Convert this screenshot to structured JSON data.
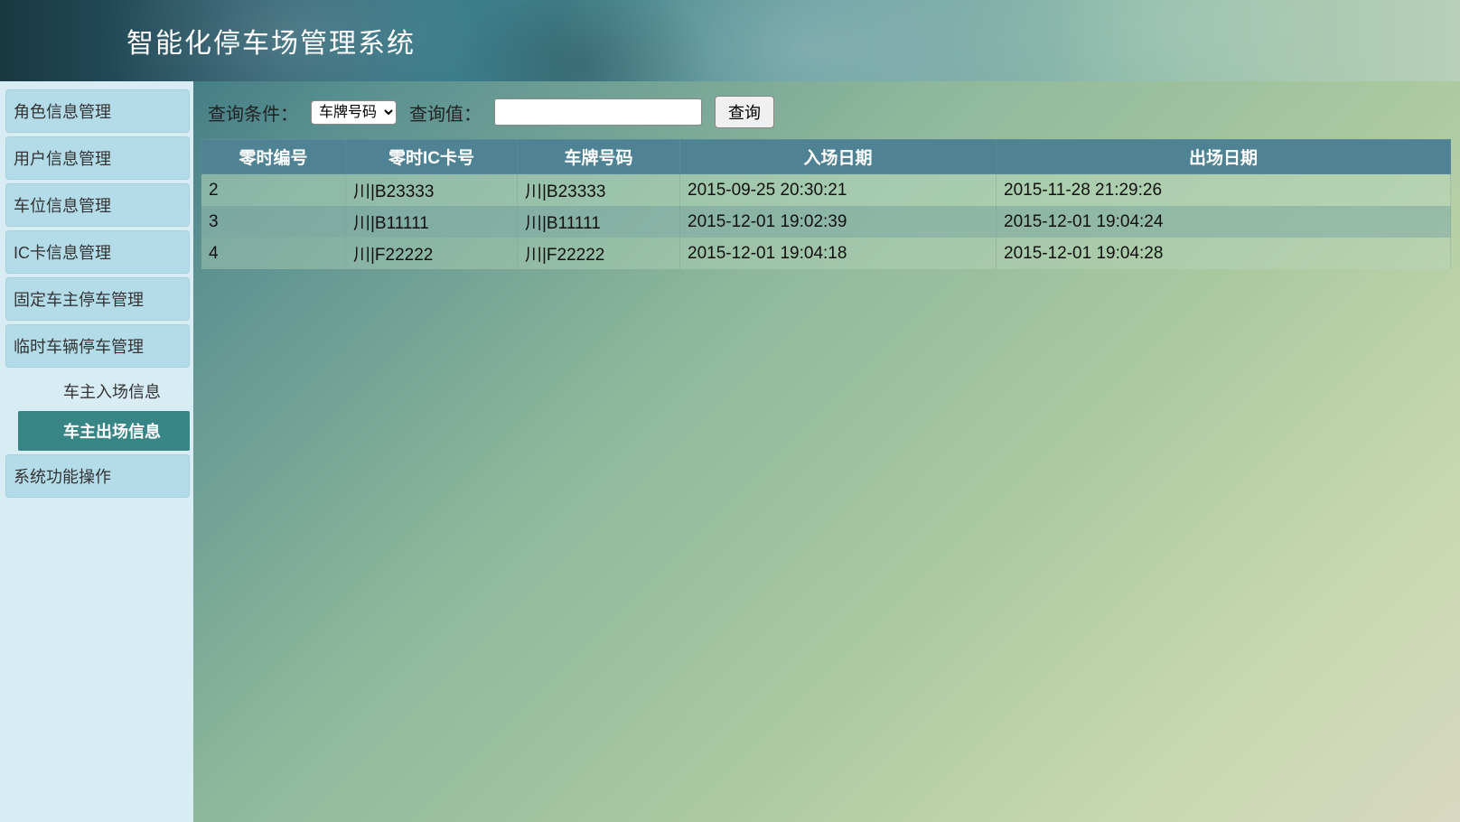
{
  "header": {
    "title": "智能化停车场管理系统"
  },
  "sidebar": {
    "items": [
      {
        "label": "角色信息管理",
        "type": "main"
      },
      {
        "label": "用户信息管理",
        "type": "main"
      },
      {
        "label": "车位信息管理",
        "type": "main"
      },
      {
        "label": "IC卡信息管理",
        "type": "main"
      },
      {
        "label": "固定车主停车管理",
        "type": "main"
      },
      {
        "label": "临时车辆停车管理",
        "type": "main"
      },
      {
        "label": "车主入场信息",
        "type": "sub",
        "active": false
      },
      {
        "label": "车主出场信息",
        "type": "sub",
        "active": true
      },
      {
        "label": "系统功能操作",
        "type": "main"
      }
    ]
  },
  "query": {
    "condition_label": "查询条件：",
    "condition_selected": "车牌号码",
    "value_label": "查询值：",
    "value": "",
    "button_label": "查询"
  },
  "table": {
    "headers": [
      "零时编号",
      "零时IC卡号",
      "车牌号码",
      "入场日期",
      "出场日期"
    ],
    "rows": [
      {
        "id": "2",
        "ic": "川|B23333",
        "plate": "川|B23333",
        "in_time": "2015-09-25 20:30:21",
        "out_time": "2015-11-28 21:29:26"
      },
      {
        "id": "3",
        "ic": "川|B11111",
        "plate": "川|B11111",
        "in_time": "2015-12-01 19:02:39",
        "out_time": "2015-12-01 19:04:24"
      },
      {
        "id": "4",
        "ic": "川|F22222",
        "plate": "川|F22222",
        "in_time": "2015-12-01 19:04:18",
        "out_time": "2015-12-01 19:04:28"
      }
    ]
  }
}
